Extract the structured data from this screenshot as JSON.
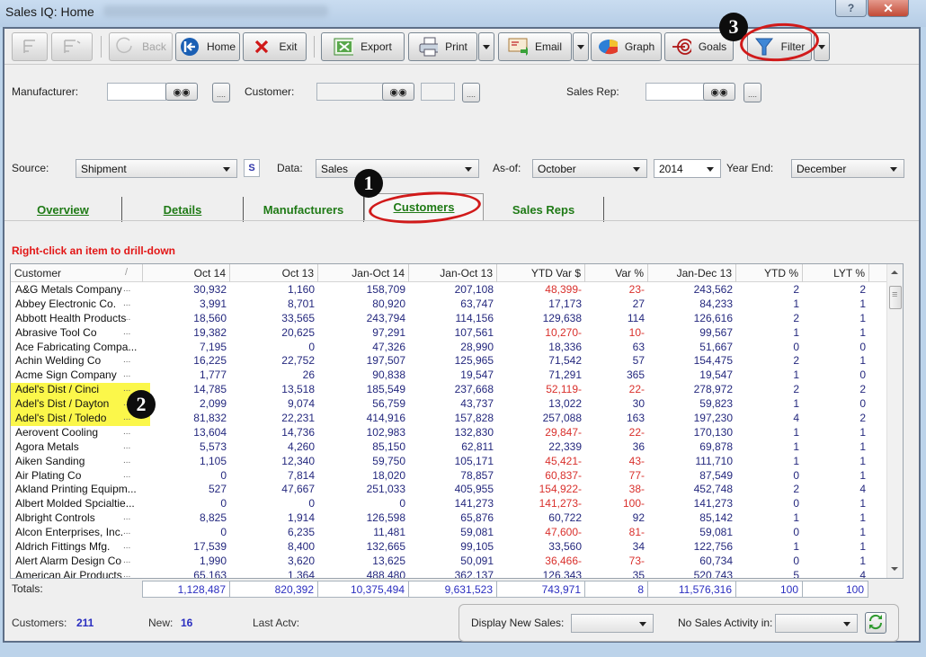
{
  "window": {
    "title": "Sales IQ: Home",
    "help_icon": "?",
    "close_icon": "✕"
  },
  "toolbar": {
    "back": "Back",
    "home": "Home",
    "exit": "Exit",
    "export": "Export",
    "print": "Print",
    "email": "Email",
    "graph": "Graph",
    "goals": "Goals",
    "filter": "Filter"
  },
  "filters": {
    "manufacturer_label": "Manufacturer:",
    "manufacturer_value": "",
    "customer_label": "Customer:",
    "customer_value": "",
    "salesrep_label": "Sales Rep:",
    "salesrep_value": "",
    "dots_label": "....",
    "source_label": "Source:",
    "source_value": "Shipment",
    "s_button": "S",
    "data_label": "Data:",
    "data_value": "Sales",
    "asof_label": "As-of:",
    "asof_month": "October",
    "asof_year": "2014",
    "yearend_label": "Year End:",
    "yearend_value": "December"
  },
  "tabs": [
    {
      "label": "Overview",
      "active": false
    },
    {
      "label": "Details",
      "active": false
    },
    {
      "label": "Manufacturers",
      "active": false
    },
    {
      "label": "Customers",
      "active": true
    },
    {
      "label": "Sales Reps",
      "active": false
    }
  ],
  "hint": "Right-click an item to drill-down",
  "grid": {
    "columns": [
      "Customer",
      "Oct 14",
      "Oct 13",
      "Jan-Oct 14",
      "Jan-Oct 13",
      "YTD Var $",
      "Var %",
      "Jan-Dec 13",
      "YTD %",
      "LYT %"
    ],
    "sort_indicator": "/",
    "rows": [
      {
        "name": "A&G Metals Company",
        "v": [
          "30,932",
          "1,160",
          "158,709",
          "207,108",
          "48,399-",
          "23-",
          "243,562",
          "2",
          "2"
        ],
        "hl": false
      },
      {
        "name": "Abbey Electronic Co.",
        "v": [
          "3,991",
          "8,701",
          "80,920",
          "63,747",
          "17,173",
          "27",
          "84,233",
          "1",
          "1"
        ],
        "hl": false
      },
      {
        "name": "Abbott Health Products",
        "v": [
          "18,560",
          "33,565",
          "243,794",
          "114,156",
          "129,638",
          "114",
          "126,616",
          "2",
          "1"
        ],
        "hl": false
      },
      {
        "name": "Abrasive Tool Co",
        "v": [
          "19,382",
          "20,625",
          "97,291",
          "107,561",
          "10,270-",
          "10-",
          "99,567",
          "1",
          "1"
        ],
        "hl": false
      },
      {
        "name": "Ace Fabricating Compa...",
        "v": [
          "7,195",
          "0",
          "47,326",
          "28,990",
          "18,336",
          "63",
          "51,667",
          "0",
          "0"
        ],
        "hl": false
      },
      {
        "name": "Achin Welding Co",
        "v": [
          "16,225",
          "22,752",
          "197,507",
          "125,965",
          "71,542",
          "57",
          "154,475",
          "2",
          "1"
        ],
        "hl": false
      },
      {
        "name": "Acme Sign Company",
        "v": [
          "1,777",
          "26",
          "90,838",
          "19,547",
          "71,291",
          "365",
          "19,547",
          "1",
          "0"
        ],
        "hl": false
      },
      {
        "name": "Adel's Dist / Cinci",
        "v": [
          "14,785",
          "13,518",
          "185,549",
          "237,668",
          "52,119-",
          "22-",
          "278,972",
          "2",
          "2"
        ],
        "hl": true
      },
      {
        "name": "Adel's Dist / Dayton",
        "v": [
          "2,099",
          "9,074",
          "56,759",
          "43,737",
          "13,022",
          "30",
          "59,823",
          "1",
          "0"
        ],
        "hl": true
      },
      {
        "name": "Adel's Dist / Toledo",
        "v": [
          "81,832",
          "22,231",
          "414,916",
          "157,828",
          "257,088",
          "163",
          "197,230",
          "4",
          "2"
        ],
        "hl": true
      },
      {
        "name": "Aerovent Cooling",
        "v": [
          "13,604",
          "14,736",
          "102,983",
          "132,830",
          "29,847-",
          "22-",
          "170,130",
          "1",
          "1"
        ],
        "hl": false
      },
      {
        "name": "Agora Metals",
        "v": [
          "5,573",
          "4,260",
          "85,150",
          "62,811",
          "22,339",
          "36",
          "69,878",
          "1",
          "1"
        ],
        "hl": false
      },
      {
        "name": "Aiken Sanding",
        "v": [
          "1,105",
          "12,340",
          "59,750",
          "105,171",
          "45,421-",
          "43-",
          "111,710",
          "1",
          "1"
        ],
        "hl": false
      },
      {
        "name": "Air Plating Co",
        "v": [
          "0",
          "7,814",
          "18,020",
          "78,857",
          "60,837-",
          "77-",
          "87,549",
          "0",
          "1"
        ],
        "hl": false
      },
      {
        "name": "Akland Printing Equipm...",
        "v": [
          "527",
          "47,667",
          "251,033",
          "405,955",
          "154,922-",
          "38-",
          "452,748",
          "2",
          "4"
        ],
        "hl": false
      },
      {
        "name": "Albert Molded Spcialtie...",
        "v": [
          "0",
          "0",
          "0",
          "141,273",
          "141,273-",
          "100-",
          "141,273",
          "0",
          "1"
        ],
        "hl": false
      },
      {
        "name": "Albright Controls",
        "v": [
          "8,825",
          "1,914",
          "126,598",
          "65,876",
          "60,722",
          "92",
          "85,142",
          "1",
          "1"
        ],
        "hl": false
      },
      {
        "name": "Alcon Enterprises, Inc.",
        "v": [
          "0",
          "6,235",
          "11,481",
          "59,081",
          "47,600-",
          "81-",
          "59,081",
          "0",
          "1"
        ],
        "hl": false
      },
      {
        "name": "Aldrich Fittings Mfg.",
        "v": [
          "17,539",
          "8,400",
          "132,665",
          "99,105",
          "33,560",
          "34",
          "122,756",
          "1",
          "1"
        ],
        "hl": false
      },
      {
        "name": "Alert Alarm Design Co",
        "v": [
          "1,990",
          "3,620",
          "13,625",
          "50,091",
          "36,466-",
          "73-",
          "60,734",
          "0",
          "1"
        ],
        "hl": false
      },
      {
        "name": "American Air Products",
        "v": [
          "65,163",
          "1,364",
          "488,480",
          "362,137",
          "126,343",
          "35",
          "520,743",
          "5",
          "4"
        ],
        "hl": false
      }
    ],
    "totals_label": "Totals:",
    "totals": [
      "1,128,487",
      "820,392",
      "10,375,494",
      "9,631,523",
      "743,971",
      "8",
      "11,576,316",
      "100",
      "100"
    ]
  },
  "footer": {
    "customers_label": "Customers:",
    "customers_value": "211",
    "new_label": "New:",
    "new_value": "16",
    "lastactv_label": "Last Actv:",
    "display_new_sales_label": "Display New Sales:",
    "display_new_sales_value": "",
    "no_sales_activity_label": "No Sales Activity in:",
    "no_sales_activity_value": ""
  },
  "annotations": [
    "1",
    "2",
    "3"
  ],
  "colors": {
    "value_blue": "#24287e",
    "negative_red": "#d9302c",
    "tab_green": "#1f7a16",
    "highlight_yellow": "#fbf74a",
    "hint_red": "#e21616",
    "annotation_ring": "#d11a1a"
  }
}
